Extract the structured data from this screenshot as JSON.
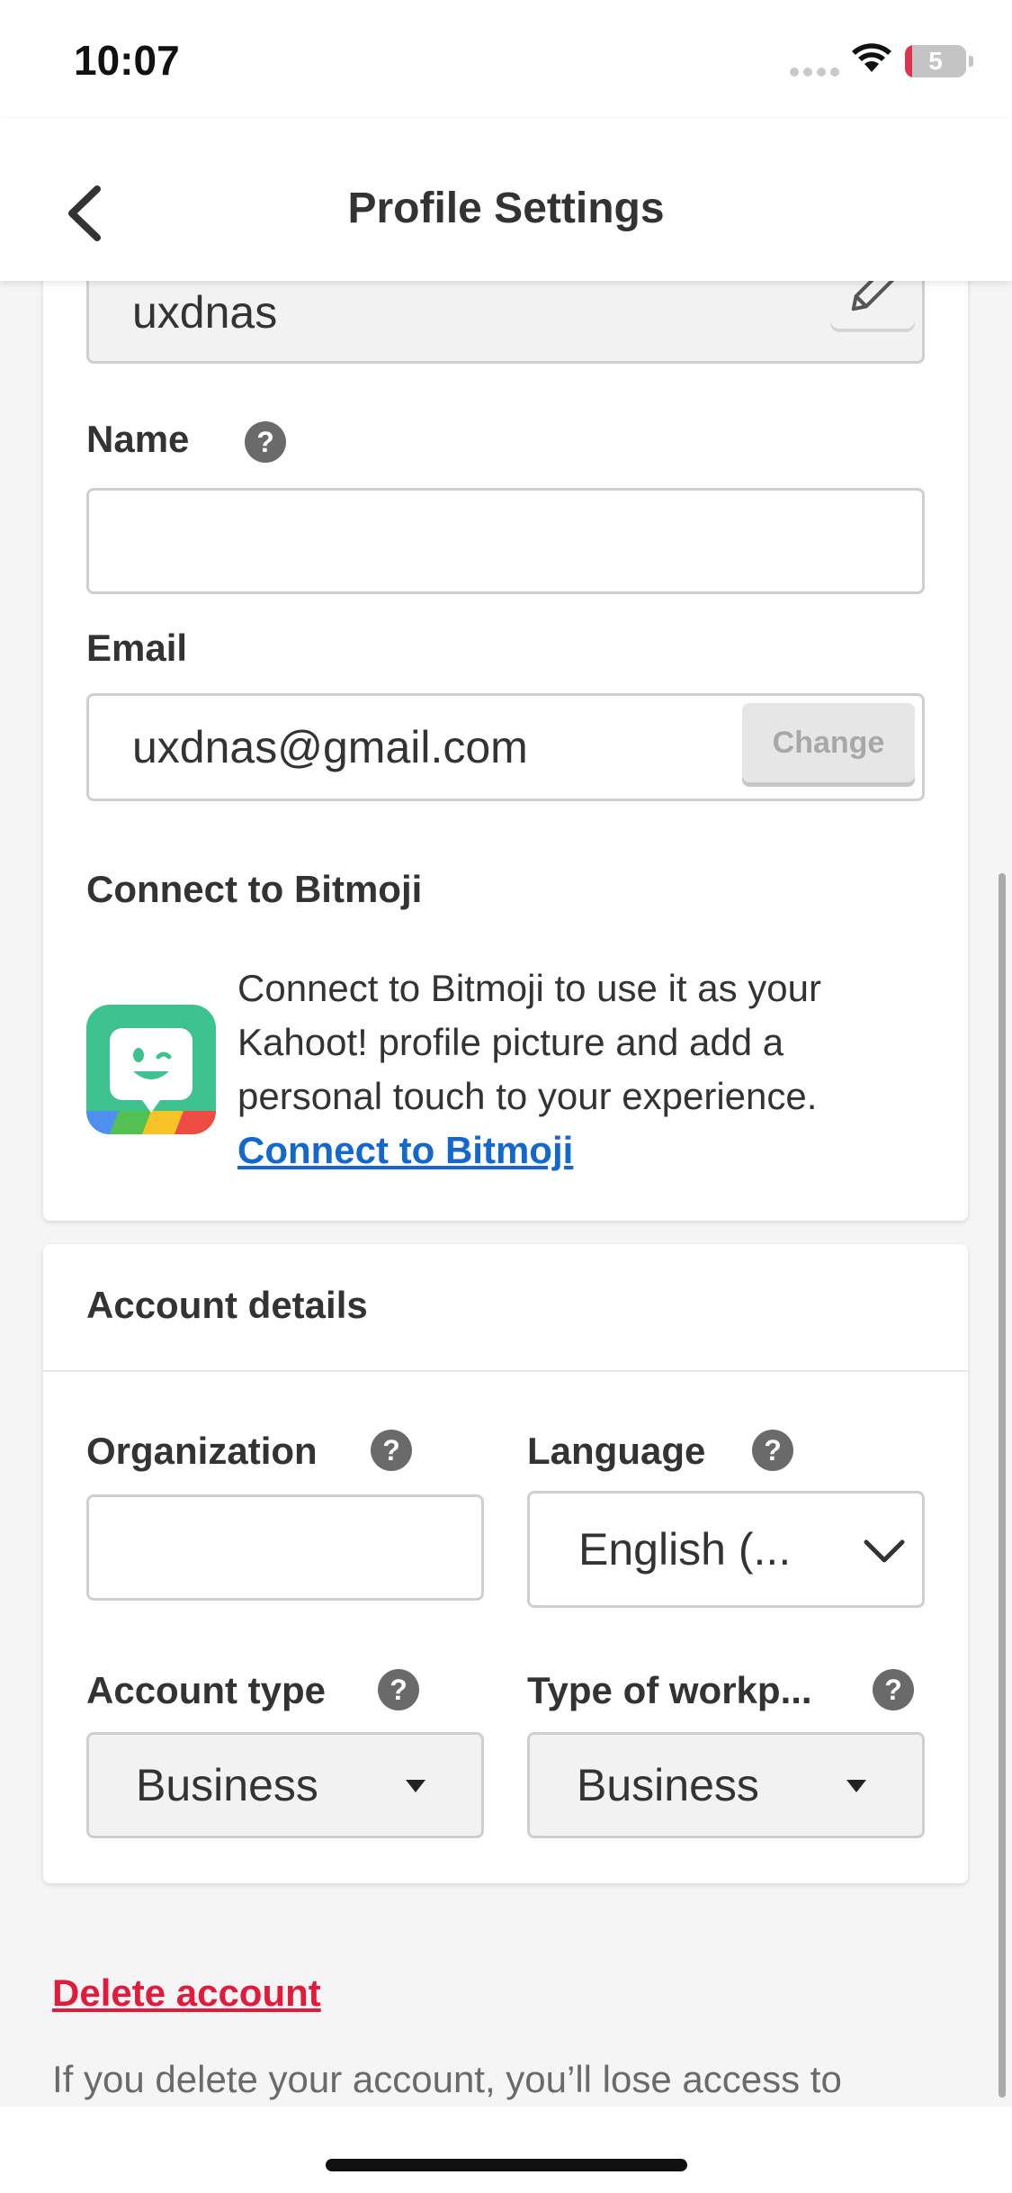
{
  "status_bar": {
    "time": "10:07",
    "battery_level": "5",
    "icons": [
      "signal-dots-icon",
      "wifi-icon",
      "battery-icon"
    ]
  },
  "header": {
    "title": "Profile Settings",
    "back_icon": "chevron-left-icon"
  },
  "profile": {
    "username_value": "uxdnas",
    "edit_icon": "pencil-icon",
    "name_label": "Name",
    "name_value": "",
    "email_label": "Email",
    "email_value": "uxdnas@gmail.com",
    "change_label": "Change",
    "bitmoji_heading": "Connect to Bitmoji",
    "bitmoji_description": "Connect to Bitmoji to use it as your Kahoot! profile picture and add a personal touch to your experience.",
    "bitmoji_link": "Connect to Bitmoji"
  },
  "account_details": {
    "heading": "Account details",
    "organization_label": "Organization",
    "organization_value": "",
    "language_label": "Language",
    "language_value": "English (...",
    "account_type_label": "Account type",
    "account_type_value": "Business",
    "workplace_label": "Type of workp...",
    "workplace_value": "Business"
  },
  "delete": {
    "link_label": "Delete account",
    "description": "If you delete your account, you’ll lose access to"
  },
  "help_icon_glyph": "?",
  "colors": {
    "link_blue": "#1368ce",
    "delete_red": "#e21b3c",
    "bitmoji_green": "#3ec28f",
    "help_icon_grey": "#6a6a6a"
  }
}
